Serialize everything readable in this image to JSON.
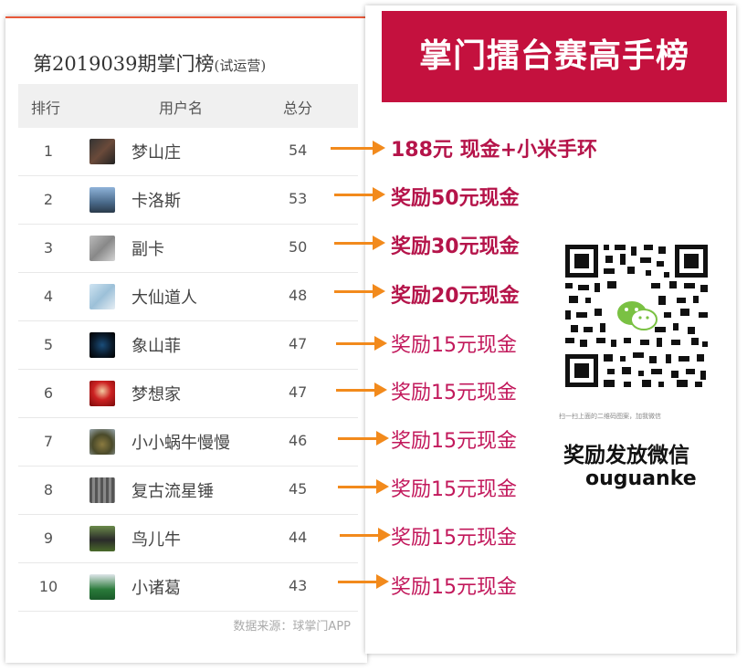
{
  "board": {
    "title": "第2019039期掌门榜",
    "title_note": "(试运营)",
    "columns": [
      "排行",
      "用户名",
      "总分"
    ],
    "rows": [
      {
        "rank": "1",
        "name": "梦山庄",
        "score": "54"
      },
      {
        "rank": "2",
        "name": "卡洛斯",
        "score": "53"
      },
      {
        "rank": "3",
        "name": "副卡",
        "score": "50"
      },
      {
        "rank": "4",
        "name": "大仙道人",
        "score": "48"
      },
      {
        "rank": "5",
        "name": "象山菲",
        "score": "47"
      },
      {
        "rank": "6",
        "name": "梦想家",
        "score": "47"
      },
      {
        "rank": "7",
        "name": "小小蜗牛慢慢",
        "score": "46"
      },
      {
        "rank": "8",
        "name": "复古流星锤",
        "score": "45"
      },
      {
        "rank": "9",
        "name": "鸟儿牛",
        "score": "44"
      },
      {
        "rank": "10",
        "name": "小诸葛",
        "score": "43"
      }
    ],
    "source": "数据来源：球掌门APP"
  },
  "rewards": [
    "188元 现金+小米手环",
    "奖励50元现金",
    "奖励30元现金",
    "奖励20元现金",
    "奖励15元现金",
    "奖励15元现金",
    "奖励15元现金",
    "奖励15元现金",
    "奖励15元现金",
    "奖励15元现金"
  ],
  "promo": {
    "banner": "掌门擂台赛高手榜",
    "qr_caption": "扫一扫上面的二维码图案，加我微信",
    "wechat_title": "奖励发放微信",
    "wechat_id": "ouguanke"
  },
  "colors": {
    "banner_bg": "#c4113e",
    "reward_text": "#b5144a",
    "arrow": "#f28a1c",
    "header_accent": "#e8593a"
  }
}
